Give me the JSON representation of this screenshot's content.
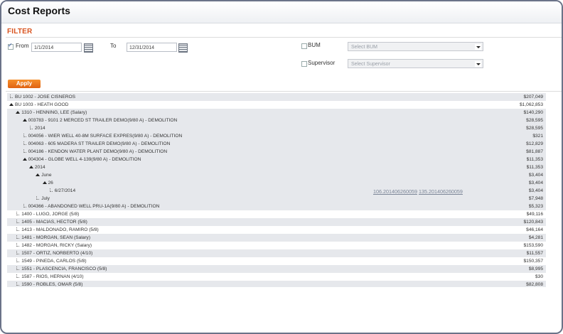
{
  "app": {
    "title": "Cost Reports"
  },
  "filter": {
    "heading": "FILTER",
    "from": {
      "label": "From",
      "checked": true,
      "value": "1/1/2014"
    },
    "to": {
      "label": "To",
      "value": "12/31/2014"
    },
    "bum": {
      "label": "BUM",
      "checked": false,
      "placeholder": "Select BUM"
    },
    "supervisor": {
      "label": "Supervisor",
      "checked": false,
      "placeholder": "Select Supervisor"
    },
    "apply_label": "Apply"
  },
  "tree": {
    "rows": [
      {
        "text": "BU 1002 - JOSE CISNEROS",
        "amount": "$207,049",
        "level": 0,
        "toggle": "leaf",
        "alt": true
      },
      {
        "text": "BU 1003 - HEATH GOOD",
        "amount": "$1,062,853",
        "level": 0,
        "toggle": "open",
        "alt": false
      },
      {
        "text": "1310 - HENNING, LEE (Salary)",
        "amount": "$140,290",
        "level": 1,
        "toggle": "open",
        "alt": true
      },
      {
        "text": "003783 - 9101 2 MERCED ST TRAILER DEMO(9/80 A) - DEMOLITION",
        "amount": "$28,595",
        "level": 2,
        "toggle": "open",
        "alt": true
      },
      {
        "text": "2014",
        "amount": "$28,595",
        "level": 3,
        "toggle": "leaf",
        "alt": true
      },
      {
        "text": "004056 - WIER WELL 40-8M SURFACE EXPRES(9/80 A) - DEMOLITION",
        "amount": "$321",
        "level": 2,
        "toggle": "leaf",
        "alt": true
      },
      {
        "text": "004063 - 605 MADERA ST TRAILER DEMO(9/80 A) - DEMOLITION",
        "amount": "$12,829",
        "level": 2,
        "toggle": "leaf",
        "alt": true
      },
      {
        "text": "004186 - KENDON WATER PLANT DEMO(9/80 A) - DEMOLITION",
        "amount": "$81,887",
        "level": 2,
        "toggle": "leaf",
        "alt": true
      },
      {
        "text": "004304 - GLOBE WELL 4-139(9/80 A) - DEMOLITION",
        "amount": "$11,353",
        "level": 2,
        "toggle": "open",
        "alt": true
      },
      {
        "text": "2014",
        "amount": "$11,353",
        "level": 3,
        "toggle": "open",
        "alt": true
      },
      {
        "text": "June",
        "amount": "$3,404",
        "level": 4,
        "toggle": "open",
        "alt": true
      },
      {
        "text": "26",
        "amount": "$3,404",
        "level": 5,
        "toggle": "open",
        "alt": true
      },
      {
        "text": "6/27/2014",
        "amount": "$3,404",
        "level": 6,
        "toggle": "leaf",
        "alt": true,
        "links": [
          "106.201406260059",
          "135.201406260059"
        ]
      },
      {
        "text": "July",
        "amount": "$7,948",
        "level": 4,
        "toggle": "leaf",
        "alt": true
      },
      {
        "text": "004366 - ABANDONED WELL PRU-1A(9/80 A) - DEMOLITION",
        "amount": "$5,323",
        "level": 2,
        "toggle": "leaf",
        "alt": true
      },
      {
        "text": "1400 - LUGO, JORGE (5/8)",
        "amount": "$49,116",
        "level": 1,
        "toggle": "leaf",
        "alt": false
      },
      {
        "text": "1405 - MACIAS, HECTOR (5/8)",
        "amount": "$120,843",
        "level": 1,
        "toggle": "leaf",
        "alt": true
      },
      {
        "text": "1413 - MALDONADO, RAMIRO (5/8)",
        "amount": "$46,164",
        "level": 1,
        "toggle": "leaf",
        "alt": false
      },
      {
        "text": "1481 - MORGAN, SEAN (Salary)",
        "amount": "$4,281",
        "level": 1,
        "toggle": "leaf",
        "alt": true
      },
      {
        "text": "1482 - MORGAN, RICKY (Salary)",
        "amount": "$153,590",
        "level": 1,
        "toggle": "leaf",
        "alt": false
      },
      {
        "text": "1507 - ORTIZ, NORBERTO (4/10)",
        "amount": "$11,557",
        "level": 1,
        "toggle": "leaf",
        "alt": true
      },
      {
        "text": "1549 - PINEDA, CARLOS (5/8)",
        "amount": "$150,357",
        "level": 1,
        "toggle": "leaf",
        "alt": false
      },
      {
        "text": "1551 - PLASCENCIA, FRANCISCO (5/8)",
        "amount": "$8,995",
        "level": 1,
        "toggle": "leaf",
        "alt": true
      },
      {
        "text": "1587 - RIOS, HERNAN (4/10)",
        "amount": "$30",
        "level": 1,
        "toggle": "leaf",
        "alt": false
      },
      {
        "text": "1590 - ROBLES, OMAR (5/8)",
        "amount": "$82,808",
        "level": 1,
        "toggle": "leaf",
        "alt": true
      }
    ]
  }
}
